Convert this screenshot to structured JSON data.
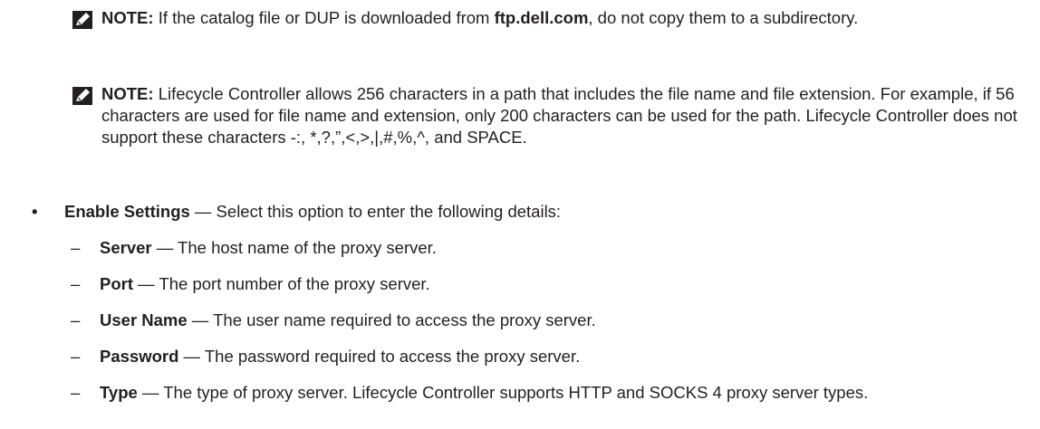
{
  "note1": {
    "label": "NOTE:",
    "text_a": " If the catalog file or DUP is downloaded from ",
    "link_text": "ftp.dell.com",
    "text_b": ", do not copy them to a subdirectory."
  },
  "note2": {
    "label": "NOTE:",
    "text": " Lifecycle Controller allows 256 characters in a path that includes the file name and file extension. For example, if 56 characters are used for file name and extension, only 200 characters can be used for the path. Lifecycle Controller does not support these characters -:, *,?,”,<,>,|,#,%,^, and SPACE."
  },
  "bullet": {
    "marker": "•",
    "term": "Enable Settings",
    "desc": " — Select this option to enter the following details:"
  },
  "sub_items": [
    {
      "marker": "–",
      "term": "Server",
      "desc": " — The host name of the proxy server."
    },
    {
      "marker": "–",
      "term": "Port",
      "desc": " — The port number of the proxy server."
    },
    {
      "marker": "–",
      "term": "User Name",
      "desc": " — The user name required to access the proxy server."
    },
    {
      "marker": "–",
      "term": "Password",
      "desc": " — The password required to access the proxy server."
    },
    {
      "marker": "–",
      "term": "Type",
      "desc": " — The type of proxy server. Lifecycle Controller supports HTTP and SOCKS 4 proxy server types."
    }
  ],
  "icons": {
    "note": "note-pencil-icon"
  }
}
